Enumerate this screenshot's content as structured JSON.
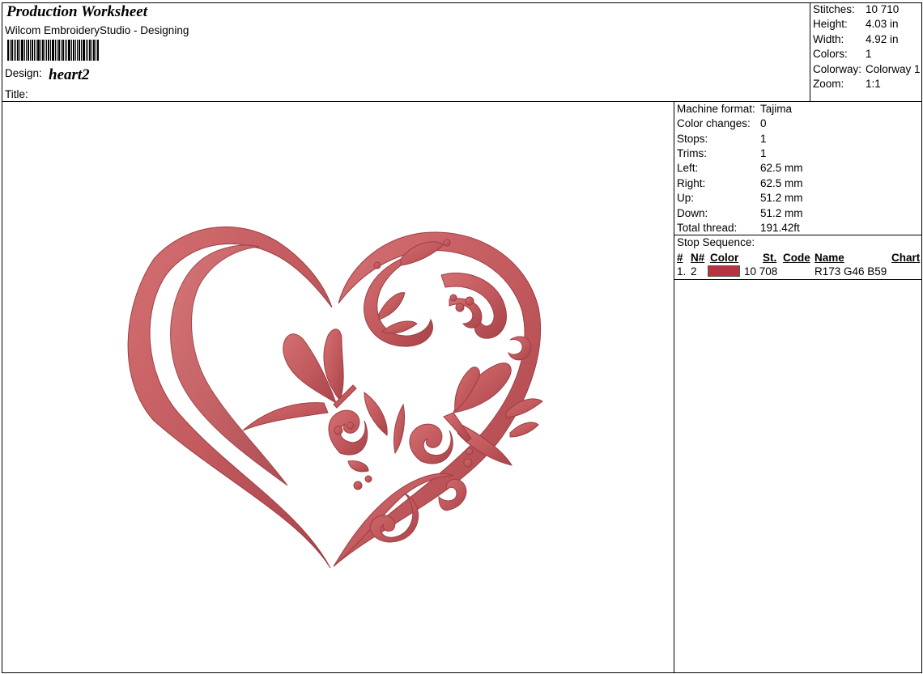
{
  "header": {
    "title": "Production Worksheet",
    "software": "Wilcom EmbroideryStudio - Designing",
    "design_label": "Design:",
    "design_name": "heart2",
    "title_label": "Title:"
  },
  "summary": [
    {
      "label": "Stitches:",
      "value": "10 710"
    },
    {
      "label": "Height:",
      "value": "4.03 in"
    },
    {
      "label": "Width:",
      "value": "4.92 in"
    },
    {
      "label": "Colors:",
      "value": "1"
    },
    {
      "label": "Colorway:",
      "value": "Colorway 1"
    },
    {
      "label": "Zoom:",
      "value": "1:1"
    }
  ],
  "machine": [
    {
      "label": "Machine format:",
      "value": "Tajima"
    },
    {
      "label": "Color changes:",
      "value": "0"
    },
    {
      "label": "Stops:",
      "value": "1"
    },
    {
      "label": "Trims:",
      "value": "1"
    },
    {
      "label": "Left:",
      "value": "62.5 mm"
    },
    {
      "label": "Right:",
      "value": "62.5 mm"
    },
    {
      "label": "Up:",
      "value": "51.2 mm"
    },
    {
      "label": "Down:",
      "value": "51.2 mm"
    },
    {
      "label": "Total thread:",
      "value": "191.42ft"
    }
  ],
  "stop_sequence": {
    "label": "Stop Sequence:",
    "columns": {
      "num": "#",
      "needle": "N#",
      "color": "Color",
      "stitches": "St.",
      "code": "Code",
      "name": "Name",
      "chart": "Chart"
    },
    "rows": [
      {
        "num": "1.",
        "needle": "2",
        "color_hex": "#b8323f",
        "stitches": "10 708",
        "code": "",
        "name": "R173 G46 B59",
        "chart": ""
      }
    ]
  },
  "colors": {
    "thread": "#c25a5e",
    "thread_dark": "#9e3e44",
    "swatch": "#b8323f"
  },
  "icons": {
    "barcode": "barcode-icon",
    "artwork": "embroidery-heart-butterflies"
  }
}
